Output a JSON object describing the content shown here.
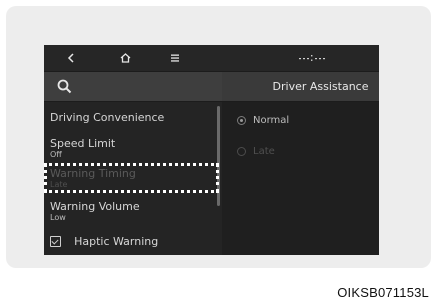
{
  "topbar": {
    "back_icon": "chevron-left-icon",
    "home_icon": "home-icon",
    "menu_icon": "menu-icon",
    "status_icon": "signal-status-icon"
  },
  "search": {
    "icon": "search-icon"
  },
  "sidebar": {
    "items": [
      {
        "label": "Driving Convenience",
        "value": ""
      },
      {
        "label": "Speed Limit",
        "value": "Off"
      },
      {
        "label": "Warning Timing",
        "value": "Late",
        "highlighted": true
      },
      {
        "label": "Warning Volume",
        "value": "Low"
      },
      {
        "label": "Haptic Warning",
        "checked": true
      }
    ]
  },
  "content": {
    "header": "Driver Assistance",
    "options": [
      {
        "label": "Normal",
        "selected": true
      },
      {
        "label": "Late",
        "selected": false
      }
    ]
  },
  "figure_code": "OIKSB071153L",
  "colors": {
    "screen_bg": "#1c1c1c",
    "header_bg": "#3a3a3a",
    "frame_bg": "#ededed",
    "highlight": "#ffffff"
  }
}
